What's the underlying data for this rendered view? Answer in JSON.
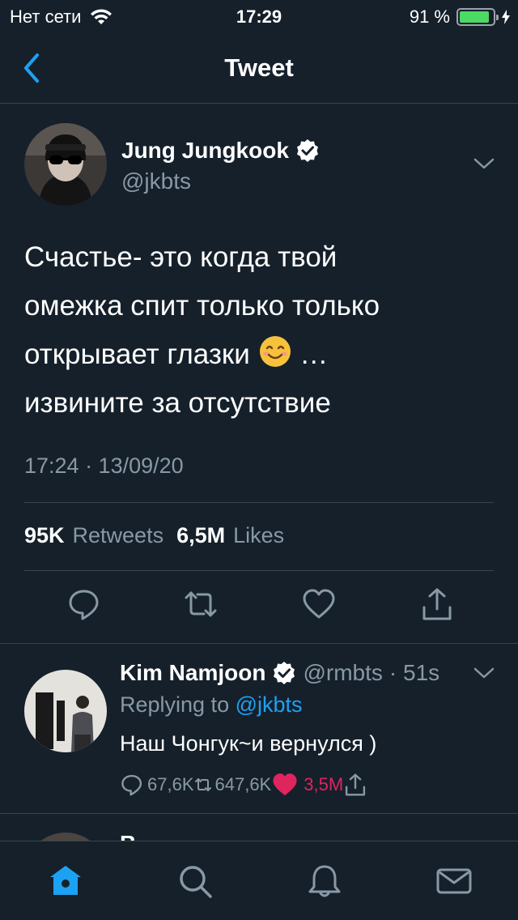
{
  "status_bar": {
    "carrier": "Нет сети",
    "time": "17:29",
    "battery_percent": "91 %",
    "battery_level": 0.91
  },
  "nav": {
    "title": "Tweet"
  },
  "tweet": {
    "author_name": "Jung Jungkook",
    "author_handle": "@jkbts",
    "text_lines": [
      "Счастье- это когда твой",
      "омежка спит только только",
      "открывает глазки",
      "…",
      "извините за отсутствие"
    ],
    "timestamp": "17:24 · 13/09/20",
    "retweets_count": "95K",
    "retweets_label": "Retweets",
    "likes_count": "6,5M",
    "likes_label": "Likes"
  },
  "reply": {
    "author_name": "Kim Namjoon",
    "author_handle": "@rmbts",
    "time_ago": "· 51s",
    "replying_prefix": "Replying to",
    "replying_to": "@jkbts",
    "text": "Наш Чонгук~и вернулся )",
    "replies": "67,6K",
    "retweets": "647,6K",
    "likes": "3,5M"
  },
  "peek": {
    "name": "B"
  },
  "colors": {
    "background": "#15202b",
    "accent": "#1da1f2",
    "muted": "#8899a6",
    "divider": "#38444d",
    "like_red": "#e0245e",
    "battery_green": "#4cd964"
  },
  "icons": {
    "back": "chevron-left-icon",
    "verified": "verified-badge-icon",
    "reply": "comment-icon",
    "retweet": "retweet-icon",
    "like": "heart-icon",
    "share": "share-icon",
    "home": "home-icon",
    "search": "search-icon",
    "notifications": "bell-icon",
    "messages": "mail-icon"
  }
}
